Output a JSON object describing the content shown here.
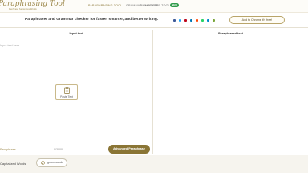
{
  "nav": {
    "logo_text": "Paraphrasing Tool",
    "logo_tagline": "Rephrase Sentences Words",
    "links": [
      "PARAPHRASING TOOL",
      "GRAMMAR CHECKER",
      "SUMMARIZER TOOL"
    ],
    "new_badge": "NEW"
  },
  "headline": {
    "text": "Paraphraser and Grammar checker for faster, smarter, and better writing.",
    "chrome_button": "Add to Chrome it's free!",
    "social_icons": [
      "facebook-icon",
      "twitter-icon",
      "pinterest-icon",
      "linkedin-icon",
      "reddit-icon",
      "whatsapp-icon",
      "telegram-icon",
      "share-icon"
    ],
    "social_colors": [
      "#3b5998",
      "#1da1f2",
      "#bd081c",
      "#0077b5",
      "#ff4500",
      "#25d366",
      "#0088cc",
      "#7aa63a"
    ]
  },
  "editor": {
    "input_title": "Input text",
    "output_title": "Paraphrased text",
    "placeholder": "Input text here...",
    "paste_label": "Paste Text",
    "footer_left": "Paraphrase",
    "counter": "0/3000",
    "advanced_button": "Advanced Paraphrase"
  },
  "bottom": {
    "capitalized_label": "Capitalized Words",
    "ignore_button": "Ignore words"
  },
  "colors": {
    "accent": "#8a7535",
    "gold_text": "#9e8a4e",
    "badge_green": "#2e9a4a"
  }
}
